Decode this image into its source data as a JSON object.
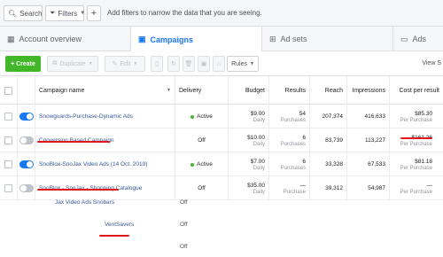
{
  "filters": {
    "search_label": "Search",
    "filters_label": "Filters",
    "add_label": "+",
    "hint": "Add filters to narrow the data that you are seeing."
  },
  "tabs": [
    {
      "label": "Account overview",
      "icon": "grid-icon"
    },
    {
      "label": "Campaigns",
      "icon": "folder-icon"
    },
    {
      "label": "Ad sets",
      "icon": "grid-icon"
    },
    {
      "label": "Ads",
      "icon": "ad-icon"
    }
  ],
  "toolbar": {
    "create": "+ Create",
    "duplicate": "Duplicate",
    "edit": "Edit",
    "rules": "Rules",
    "view": "View S"
  },
  "columns": {
    "name": "Campaign name",
    "delivery": "Delivery",
    "budget": "Budget",
    "results": "Results",
    "reach": "Reach",
    "impressions": "Impressions",
    "cpr": "Cost per result"
  },
  "rows": [
    {
      "name": "Snowguards-Purchase-Dynamic Ads",
      "delivery": "Active",
      "budget": "$9.00",
      "budget_sub": "Daily",
      "results": "54",
      "results_sub": "Purchases",
      "reach": "207,374",
      "impressions": "416,633",
      "cpr": "$85.30",
      "cpr_sub": "Per Purchase",
      "on": true
    },
    {
      "name": "Conversion Based Campaign",
      "delivery": "Off",
      "budget": "$10.00",
      "budget_sub": "Daily",
      "results": "6",
      "results_sub": "Purchases",
      "reach": "83,739",
      "impressions": "113,227",
      "cpr": "$161.26",
      "cpr_sub": "Per Purchase",
      "on": false
    },
    {
      "name": "SnoBlox-SnoJax Video Ads (14 Oct. 2019)",
      "delivery": "Active",
      "budget": "$7.00",
      "budget_sub": "Daily",
      "results": "6",
      "results_sub": "Purchases",
      "reach": "33,328",
      "impressions": "67,533",
      "cpr": "$81.18",
      "cpr_sub": "Per Purchase",
      "on": true
    },
    {
      "name": "SnoBlox - SnoJax - Shopping Catalogue",
      "delivery": "Off",
      "budget": "$35.00",
      "budget_sub": "Daily",
      "results": "—",
      "results_sub": "Purchase",
      "reach": "39,312",
      "impressions": "54,987",
      "cpr": "—",
      "cpr_sub": "Per Purchase",
      "on": false
    }
  ],
  "ghost_rows": {
    "row5_name": "Jax Video Ads Snobars",
    "row6_name": "VentSavers",
    "off1": "Off",
    "off2": "Off",
    "off3": "Off"
  }
}
